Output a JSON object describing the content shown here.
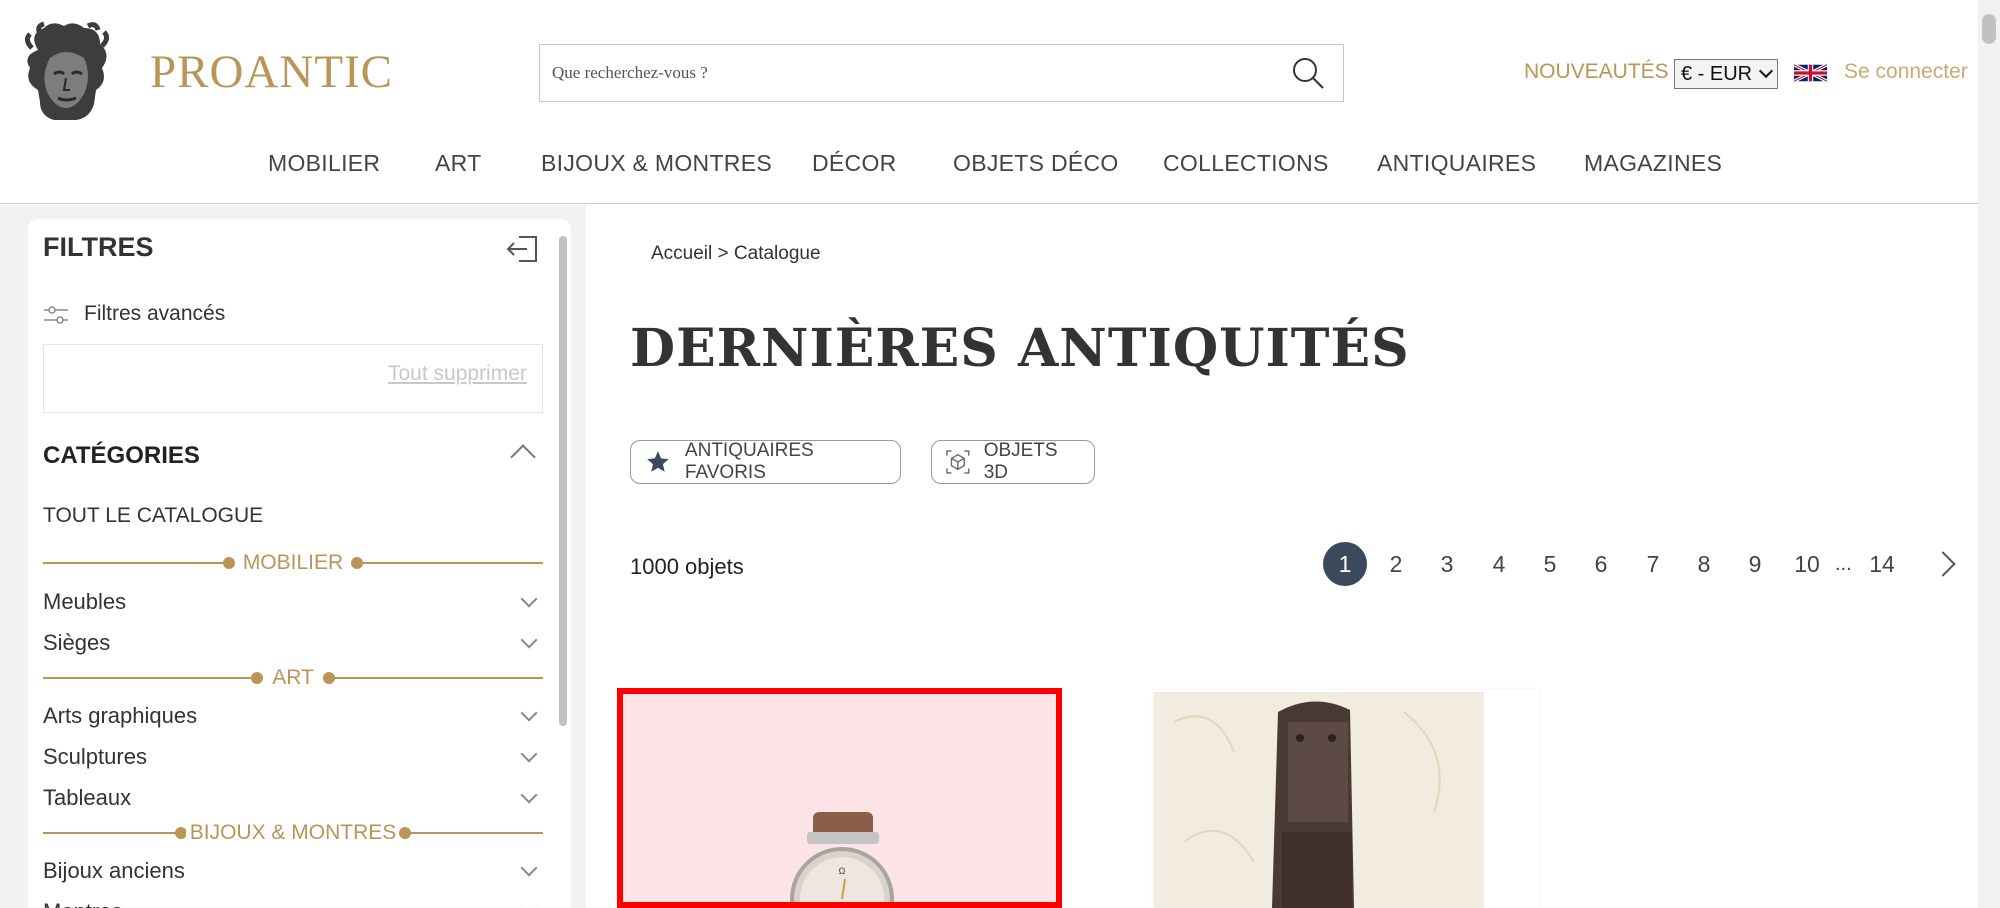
{
  "brand": {
    "name": "PROANTIC"
  },
  "search": {
    "placeholder": "Que recherchez-vous ?"
  },
  "header_links": {
    "new": "NOUVEAUTÉS",
    "currency": "€ - EUR",
    "login": "Se connecter",
    "flag": "uk-flag-icon"
  },
  "nav": [
    "MOBILIER",
    "ART",
    "BIJOUX & MONTRES",
    "DÉCOR",
    "OBJETS DÉCO",
    "COLLECTIONS",
    "ANTIQUAIRES",
    "MAGAZINES"
  ],
  "sidebar": {
    "title": "FILTRES",
    "advanced": "Filtres avancés",
    "clear_all": "Tout supprimer",
    "categories_title": "CATÉGORIES",
    "all_catalog": "TOUT LE CATALOGUE",
    "sections": [
      {
        "label": "MOBILIER",
        "items": [
          "Meubles",
          "Sièges"
        ]
      },
      {
        "label": "ART",
        "items": [
          "Arts graphiques",
          "Sculptures",
          "Tableaux"
        ]
      },
      {
        "label": "BIJOUX & MONTRES",
        "items": [
          "Bijoux anciens",
          "Montres"
        ]
      }
    ]
  },
  "breadcrumb": "Accueil > Catalogue",
  "page_title": "DERNIÈRES ANTIQUITÉS",
  "chips": {
    "favorites": "ANTIQUAIRES FAVORIS",
    "objects3d": "OBJETS 3D"
  },
  "results": {
    "count": "1000 objets"
  },
  "pagination": {
    "pages": [
      "1",
      "2",
      "3",
      "4",
      "5",
      "6",
      "7",
      "8",
      "9",
      "10"
    ],
    "ellipsis": "...",
    "last": "14",
    "current": "1"
  },
  "colors": {
    "accent": "#b99558",
    "active_page": "#3a4a5c",
    "highlight": "#ff0000"
  }
}
